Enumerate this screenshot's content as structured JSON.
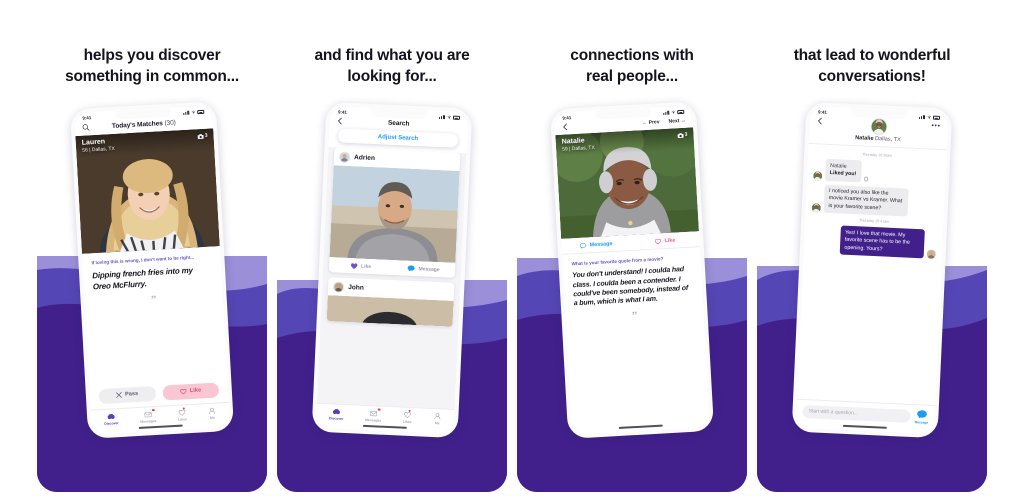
{
  "theme": {
    "purple_dark": "#41208c",
    "purple_mid": "#5546b5",
    "purple_light": "#9b8fd9",
    "accent_blue": "#1d9bf0",
    "accent_pink": "#ef5d86",
    "page_bg": "#ffffff"
  },
  "panels": [
    {
      "headline_line1": "helps you discover",
      "headline_line2": "something in common...",
      "phone": {
        "status": {
          "time": "9:41",
          "signal_icon": "signal-bars-icon",
          "wifi_icon": "wifi-icon",
          "battery_icon": "battery-icon"
        },
        "nav": {
          "search_icon": "search-icon",
          "title": "Today's Matches",
          "count": "(30)"
        },
        "profile": {
          "name": "Lauren",
          "meta": "56 | Dallas, TX",
          "photo_count": "3",
          "camera_icon": "camera-icon"
        },
        "prompt": {
          "question": "If loving this is wrong, I don't want to be right...",
          "answer": "Dipping french fries into my Oreo McFlurry.",
          "quote_glyph": "”"
        },
        "actions": [
          {
            "label": "Pass",
            "icon": "close-x-icon"
          },
          {
            "label": "Like",
            "icon": "heart-icon"
          }
        ],
        "tabs": [
          {
            "label": "Discover",
            "icon": "discover-icon",
            "active": true,
            "badge": false
          },
          {
            "label": "Messages",
            "icon": "envelope-icon",
            "active": false,
            "badge": true
          },
          {
            "label": "Likes",
            "icon": "heart-outline-icon",
            "active": false,
            "badge": true
          },
          {
            "label": "Me",
            "icon": "person-icon",
            "active": false,
            "badge": false
          }
        ]
      }
    },
    {
      "headline_line1": "and find what you are",
      "headline_line2": "looking for...",
      "phone": {
        "status": {
          "time": "9:41",
          "signal_icon": "signal-bars-icon",
          "wifi_icon": "wifi-icon",
          "battery_icon": "battery-icon"
        },
        "nav": {
          "back_icon": "chevron-left-icon",
          "title": "Search"
        },
        "adjust_button": "Adjust Search",
        "cards": [
          {
            "name": "Adrien",
            "like_label": "Like",
            "like_icon": "heart-filled-icon",
            "message_label": "Message",
            "message_icon": "chat-bubble-icon"
          },
          {
            "name": "John"
          }
        ],
        "tabs": [
          {
            "label": "Discover",
            "icon": "discover-icon",
            "active": true,
            "badge": false
          },
          {
            "label": "Messages",
            "icon": "envelope-icon",
            "active": false,
            "badge": true
          },
          {
            "label": "Likes",
            "icon": "heart-outline-icon",
            "active": false,
            "badge": true
          },
          {
            "label": "Me",
            "icon": "person-icon",
            "active": false,
            "badge": false
          }
        ]
      }
    },
    {
      "headline_line1": "connections with",
      "headline_line2": "real people...",
      "phone": {
        "status": {
          "time": "9:41",
          "signal_icon": "signal-bars-icon",
          "wifi_icon": "wifi-icon",
          "battery_icon": "battery-icon"
        },
        "nav": {
          "back_icon": "chevron-left-icon",
          "prev_label": "← Prev",
          "next_label": "Next →"
        },
        "profile": {
          "name": "Natalie",
          "meta": "59 | Dallas, TX",
          "photo_count": "3",
          "camera_icon": "camera-icon"
        },
        "actions": [
          {
            "label": "Message",
            "icon": "chat-bubble-outline-icon"
          },
          {
            "label": "Like",
            "icon": "heart-outline-icon"
          }
        ],
        "prompt": {
          "question": "What is your favorite quote from a movie?",
          "answer": "You don't understand! I coulda had class. I coulda been a contender. I could've been somebody, instead of a bum, which is what I am.",
          "quote_glyph": "”"
        }
      }
    },
    {
      "headline_line1": "that lead to wonderful",
      "headline_line2": "conversations!",
      "phone": {
        "status": {
          "time": "9:41",
          "signal_icon": "signal-bars-icon",
          "wifi_icon": "wifi-icon",
          "battery_icon": "battery-icon"
        },
        "nav": {
          "back_icon": "chevron-left-icon",
          "overflow_icon": "more-dots-icon"
        },
        "chat_header": {
          "name": "Natalie",
          "location": "Dallas, TX",
          "avatar": "avatar-natalie"
        },
        "day_separator_top": "Thursday 10:30am",
        "day_separator_mid": "Thursday 10:41am",
        "messages": [
          {
            "dir": "in",
            "sender": "Natalie",
            "text": "Liked you!",
            "has_like_reaction": true
          },
          {
            "dir": "in",
            "text": "I noticed you also like the movie Kramer vs Kramer. What is your favorite scene?"
          },
          {
            "dir": "out",
            "text": "Yes! I love that movie. My favorite scene has to be the opening. Yours?"
          }
        ],
        "composer": {
          "placeholder": "Start with a question...",
          "send_label": "Message",
          "send_icon": "chat-bubble-icon"
        }
      }
    }
  ]
}
